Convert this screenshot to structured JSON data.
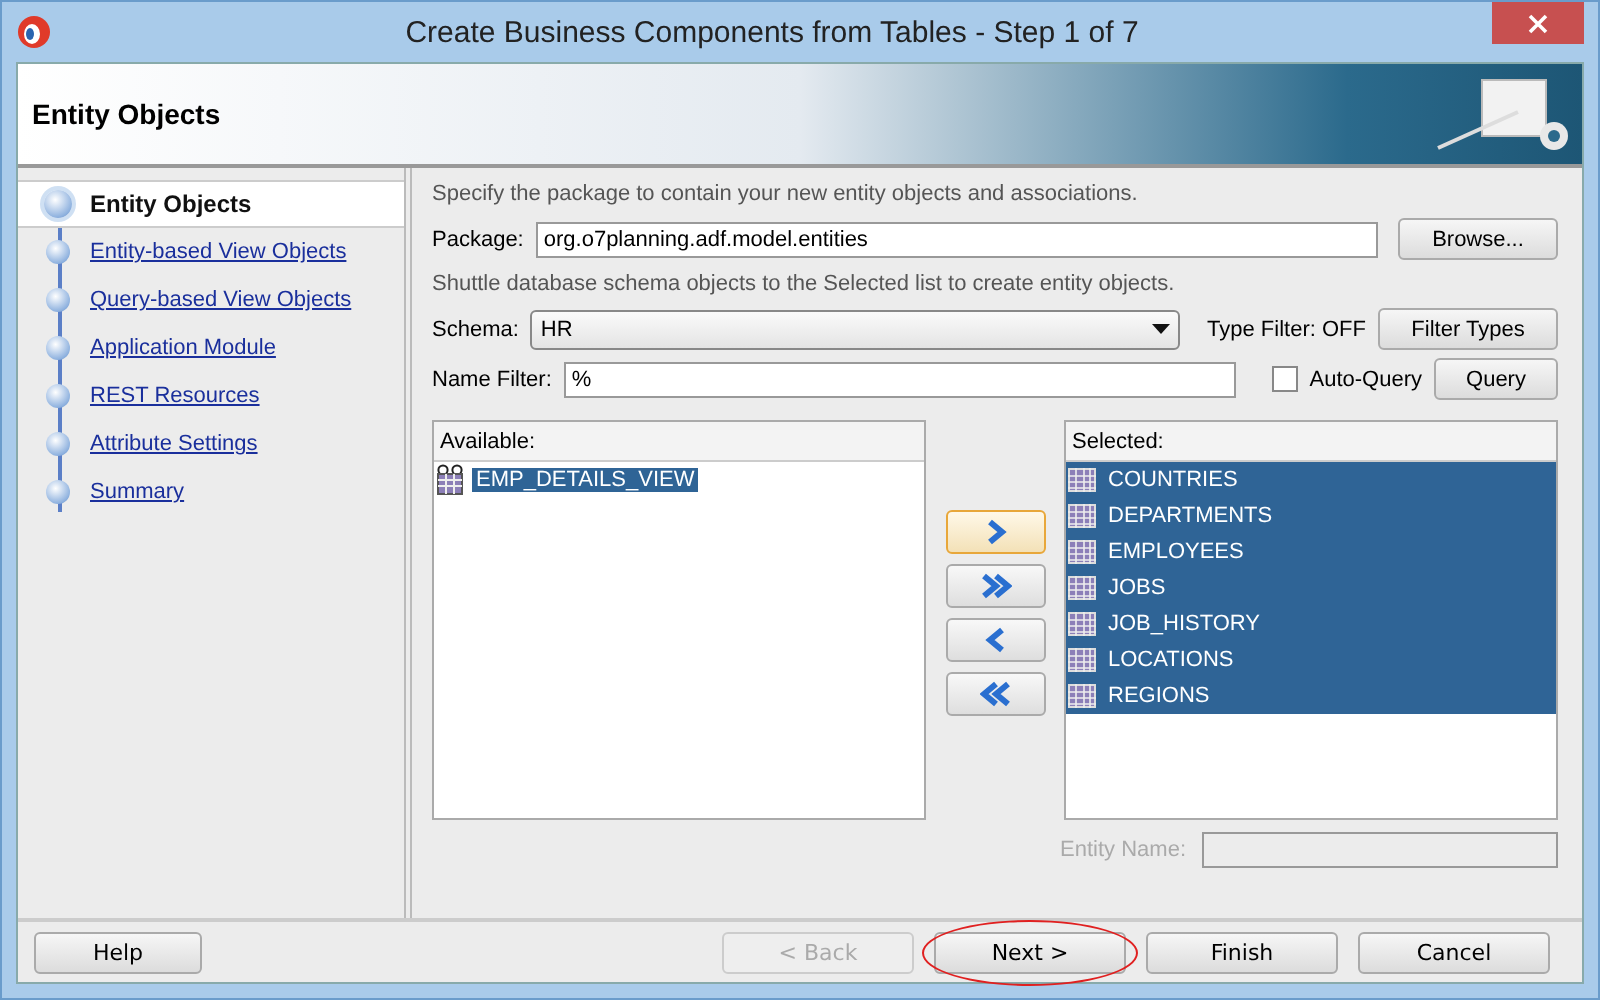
{
  "window": {
    "title": "Create Business Components from Tables - Step 1 of 7"
  },
  "header": {
    "title": "Entity Objects"
  },
  "steps": [
    {
      "label": "Entity Objects",
      "selected": true
    },
    {
      "label": "Entity-based View Objects",
      "selected": false
    },
    {
      "label": "Query-based View Objects",
      "selected": false
    },
    {
      "label": "Application Module",
      "selected": false
    },
    {
      "label": "REST Resources",
      "selected": false
    },
    {
      "label": "Attribute Settings",
      "selected": false
    },
    {
      "label": "Summary",
      "selected": false
    }
  ],
  "intro": "Specify the package to contain your new entity objects and associations.",
  "package": {
    "label": "Package:",
    "value": "org.o7planning.adf.model.entities",
    "button": "Browse..."
  },
  "hint": "Shuttle database schema objects to the Selected list to create entity objects.",
  "schema": {
    "label": "Schema:",
    "value": "HR",
    "type_filter": "Type Filter: OFF",
    "button": "Filter Types"
  },
  "name_filter": {
    "label": "Name Filter:",
    "value": "%",
    "auto_query": {
      "label": "Auto-Query",
      "checked": false
    },
    "button": "Query"
  },
  "available": {
    "title": "Available:",
    "items": [
      {
        "label": "EMP_DETAILS_VIEW",
        "selected": true,
        "kind": "view"
      }
    ]
  },
  "shuttle": [
    {
      "kind": "move",
      "focused": true
    },
    {
      "kind": "move_all",
      "focused": false
    },
    {
      "kind": "remove",
      "focused": false
    },
    {
      "kind": "remove_all",
      "focused": false
    }
  ],
  "selected_list": {
    "title": "Selected:",
    "items": [
      {
        "label": "COUNTRIES",
        "selected": true,
        "kind": "table"
      },
      {
        "label": "DEPARTMENTS",
        "selected": true,
        "kind": "table"
      },
      {
        "label": "EMPLOYEES",
        "selected": true,
        "kind": "table"
      },
      {
        "label": "JOBS",
        "selected": true,
        "kind": "table"
      },
      {
        "label": "JOB_HISTORY",
        "selected": true,
        "kind": "table"
      },
      {
        "label": "LOCATIONS",
        "selected": true,
        "kind": "table"
      },
      {
        "label": "REGIONS",
        "selected": true,
        "kind": "table"
      }
    ]
  },
  "entity_name": {
    "label": "Entity Name:",
    "disabled": true
  },
  "footer": {
    "help": "Help",
    "buttons": [
      {
        "label": "< Back",
        "disabled": true,
        "circled": false
      },
      {
        "label": "Next >",
        "disabled": false,
        "circled": true
      },
      {
        "label": "Finish",
        "disabled": false,
        "circled": false
      },
      {
        "label": "Cancel",
        "disabled": false,
        "circled": false
      }
    ]
  }
}
